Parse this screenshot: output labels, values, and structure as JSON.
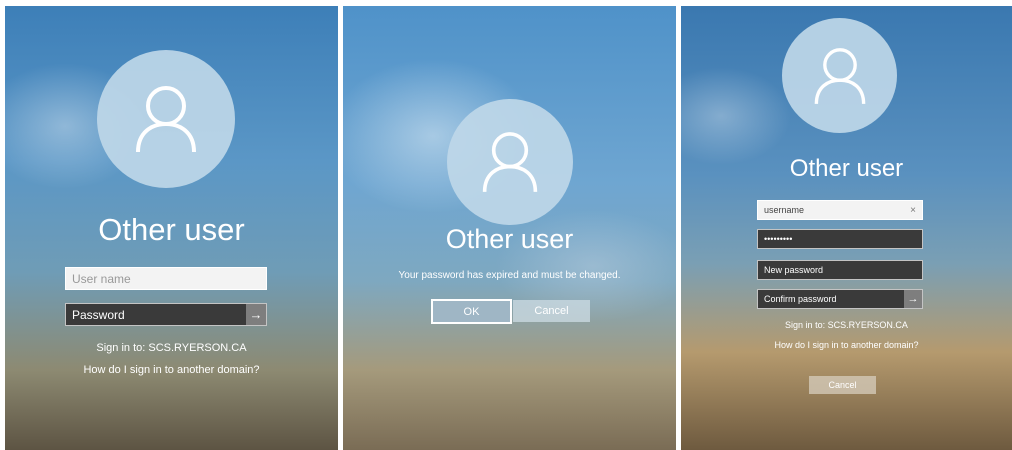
{
  "panel1": {
    "title": "Other user",
    "username_placeholder": "User name",
    "password_placeholder": "Password",
    "submit_icon": "arrow-right-icon",
    "sign_in_to": "Sign in to: SCS.RYERSON.CA",
    "other_domain_link": "How do I sign in to another domain?"
  },
  "panel2": {
    "title": "Other user",
    "message": "Your password has expired and must be changed.",
    "ok_label": "OK",
    "cancel_label": "Cancel"
  },
  "panel3": {
    "title": "Other user",
    "username_value": "username",
    "clear_icon": "×",
    "password_value": "•••••••••",
    "new_password_placeholder": "New password",
    "confirm_password_placeholder": "Confirm password",
    "sign_in_to": "Sign in to: SCS.RYERSON.CA",
    "other_domain_link": "How do I sign in to another domain?",
    "cancel_label": "Cancel"
  },
  "icons": {
    "avatar": "user-icon",
    "submit": "arrow-right-icon",
    "clear": "close-icon"
  },
  "colors": {
    "dark_field": "#3a3a3a",
    "light_field": "#f3f3f3",
    "avatar_bg": "#bed7e8"
  }
}
